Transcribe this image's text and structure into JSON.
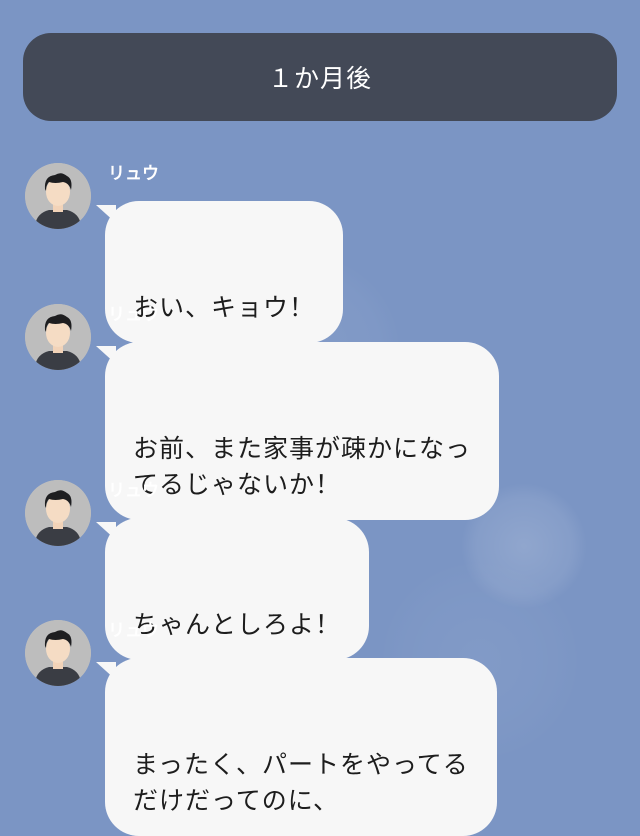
{
  "chat": {
    "time_banner": "１か月後",
    "messages": [
      {
        "sender": "リュウ",
        "text": "おい、キョウ！"
      },
      {
        "sender": "リュウ",
        "text": "お前、また家事が疎かになっ\nてるじゃないか！"
      },
      {
        "sender": "リュウ",
        "text": "ちゃんとしろよ！"
      },
      {
        "sender": "リュウ",
        "text": "まったく、パートをやってる\nだけだってのに、"
      }
    ]
  },
  "colors": {
    "background": "#7b95c4",
    "banner": "#434957",
    "bubble": "#f7f7f7",
    "text": "#1d1d1d"
  },
  "icons": {
    "avatar": "male-avatar-icon"
  }
}
